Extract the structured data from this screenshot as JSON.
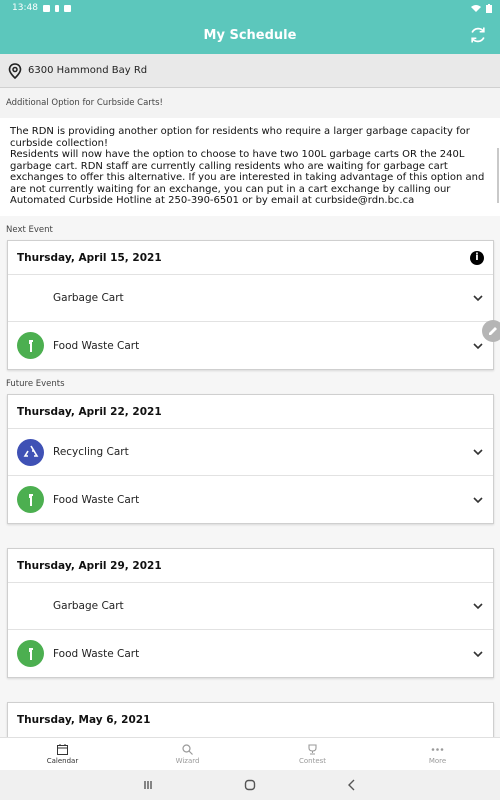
{
  "status": {
    "time": "13:48"
  },
  "app": {
    "title": "My Schedule"
  },
  "address": "6300 Hammond Bay Rd",
  "notice": {
    "title": "Additional Option for Curbside Carts!",
    "body": "The RDN is providing another option for residents who require a larger garbage capacity for curbside collection!\nResidents will now have the option to choose to have two 100L garbage carts OR the 240L garbage cart. RDN staff are currently calling residents who are waiting for garbage cart exchanges to offer this alternative. If you are interested in taking advantage of this option and are not currently waiting for an exchange, you can put in a cart exchange by calling our Automated Curbside Hotline at 250-390-6501 or by email at curbside@rdn.bc.ca"
  },
  "labels": {
    "next_event": "Next Event",
    "future_events": "Future Events"
  },
  "next_event": {
    "date": "Thursday, April 15, 2021",
    "items": [
      {
        "label": "Garbage Cart",
        "icon": "none"
      },
      {
        "label": "Food Waste Cart",
        "icon": "food-waste-icon",
        "color": "#4caf50"
      }
    ]
  },
  "future_events": [
    {
      "date": "Thursday, April 22, 2021",
      "items": [
        {
          "label": "Recycling Cart",
          "icon": "recycling-icon",
          "color": "#3f51b5"
        },
        {
          "label": "Food Waste Cart",
          "icon": "food-waste-icon",
          "color": "#4caf50"
        }
      ]
    },
    {
      "date": "Thursday, April 29, 2021",
      "items": [
        {
          "label": "Garbage Cart",
          "icon": "none"
        },
        {
          "label": "Food Waste Cart",
          "icon": "food-waste-icon",
          "color": "#4caf50"
        }
      ]
    },
    {
      "date": "Thursday, May 6, 2021",
      "items": []
    }
  ],
  "nav": [
    {
      "label": "Calendar",
      "icon": "calendar-icon",
      "active": true
    },
    {
      "label": "Wizard",
      "icon": "wizard-search-icon",
      "active": false
    },
    {
      "label": "Contest",
      "icon": "trophy-icon",
      "active": false
    },
    {
      "label": "More",
      "icon": "more-dots-icon",
      "active": false
    }
  ],
  "colors": {
    "header": "#5cc7bc",
    "food_waste": "#4caf50",
    "recycling": "#3f51b5"
  }
}
